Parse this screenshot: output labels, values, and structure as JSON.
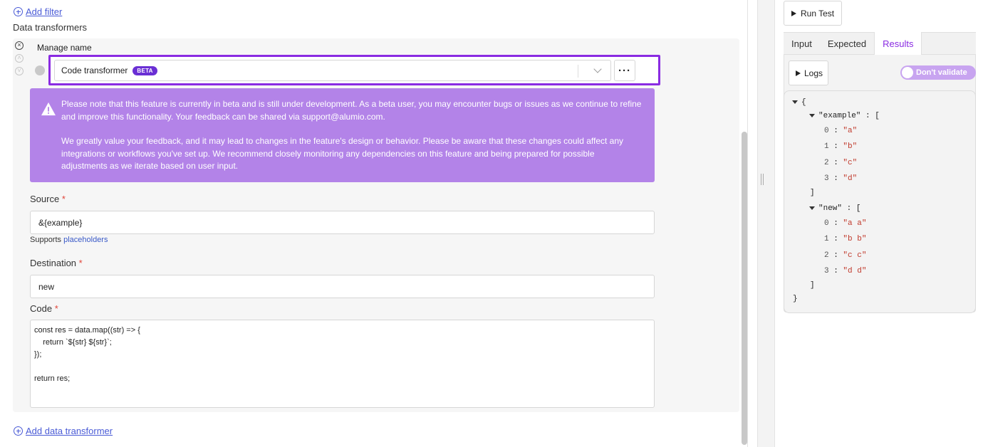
{
  "editor": {
    "add_filter_label": "Add filter",
    "section_title": "Data transformers",
    "manage_name_label": "Manage name",
    "transformer_select_value": "Code transformer",
    "beta_badge": "BETA",
    "notice_paragraph_1": "Please note that this feature is currently in beta and is still under development. As a beta user, you may encounter bugs or issues as we continue to refine and improve this functionality. Your feedback can be shared via support@alumio.com.",
    "notice_paragraph_2": "We greatly value your feedback, and it may lead to changes in the feature's design or behavior. Please be aware that these changes could affect any integrations or workflows you've set up. We recommend closely monitoring any dependencies on this feature and being prepared for possible adjustments as we iterate based on user input.",
    "source_label": "Source",
    "source_value": "&{example}",
    "hint_prefix": "Supports",
    "hint_link": "placeholders",
    "destination_label": "Destination",
    "destination_value": "new",
    "code_label": "Code",
    "code_value": "const res = data.map((str) => {\n    return `${str} ${str}`;\n});\n\nreturn res;",
    "required_marker": "*",
    "add_transformer_label": "Add data transformer"
  },
  "test_panel": {
    "run_button": "Run Test",
    "tabs": [
      "Input",
      "Expected",
      "Results"
    ],
    "active_tab": "Results",
    "logs_button": "Logs",
    "toggle_label": "Don't validate",
    "json": {
      "open_brace": "{",
      "close_brace": "}",
      "example_key": "\"example\"",
      "example_values": [
        "\"a\"",
        "\"b\"",
        "\"c\"",
        "\"d\""
      ],
      "new_key": "\"new\"",
      "new_values": [
        "\"a a\"",
        "\"b b\"",
        "\"c c\"",
        "\"d d\""
      ],
      "indices": [
        "0",
        "1",
        "2",
        "3"
      ]
    }
  },
  "colors": {
    "accent_purple": "#8a2be2",
    "notice_background": "#b383e8",
    "link_blue": "#4a5bd6",
    "json_string": "#c0392b"
  }
}
